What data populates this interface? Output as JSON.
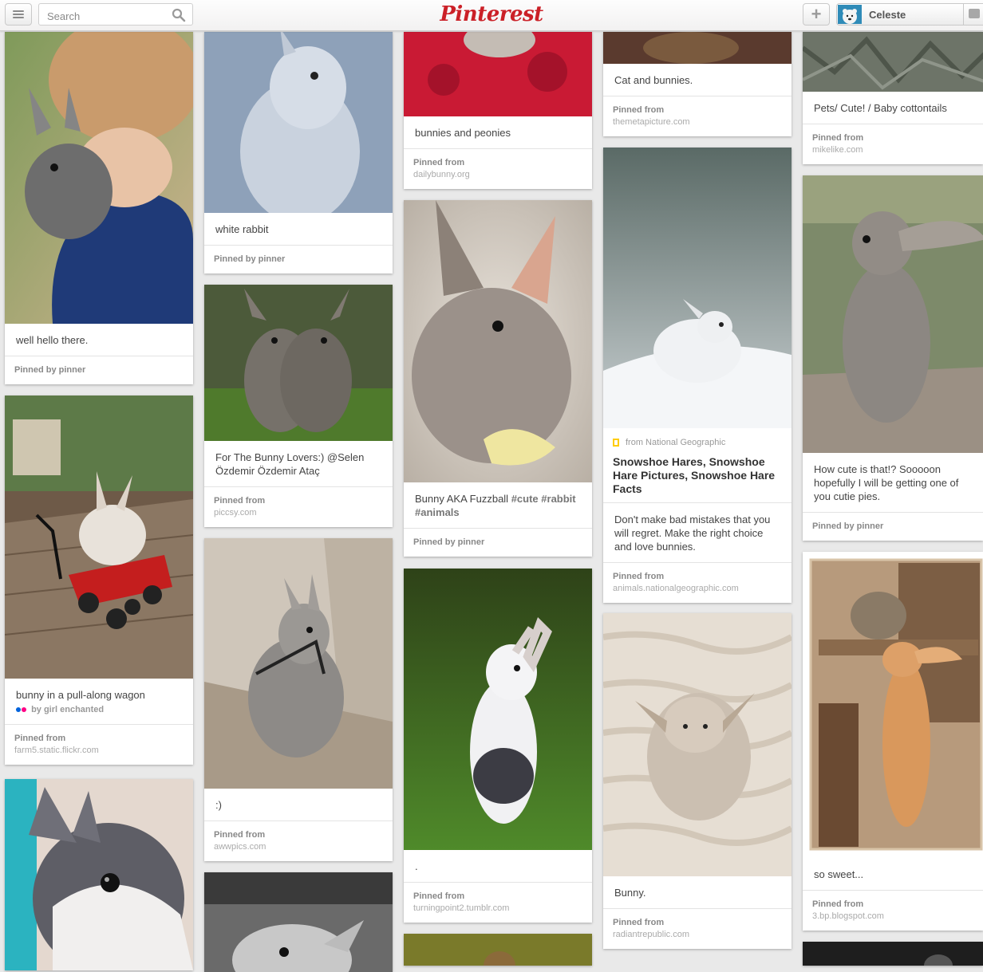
{
  "header": {
    "search_placeholder": "Search",
    "logo_text": "Pinterest",
    "user_name": "Celeste",
    "add_label": "+"
  },
  "colors": {
    "brand_red": "#cb2027",
    "background": "#e9e9e9"
  },
  "pins": [
    {
      "id": "c1p1",
      "description": "well hello there.",
      "attribution_label": "Pinned by pinner"
    },
    {
      "id": "c1p2",
      "description": "bunny in a pull-along wagon",
      "via": "by girl enchanted",
      "attribution_label": "Pinned from",
      "attribution_source": "farm5.static.flickr.com"
    },
    {
      "id": "c2p1",
      "description": "white rabbit",
      "attribution_label": "Pinned by pinner"
    },
    {
      "id": "c2p2",
      "description": "For The Bunny Lovers:) @Selen Özdemir Özdemir Ataç",
      "attribution_label": "Pinned from",
      "attribution_source": "piccsy.com"
    },
    {
      "id": "c2p3",
      "description": ":)",
      "attribution_label": "Pinned from",
      "attribution_source": "awwpics.com"
    },
    {
      "id": "c3p1",
      "description": "bunnies and peonies",
      "attribution_label": "Pinned from",
      "attribution_source": "dailybunny.org"
    },
    {
      "id": "c3p2",
      "description": "Bunny AKA Fuzzball ",
      "tag1": "#cute",
      "tag2": "#rabbit",
      "tag3": "#animals",
      "attribution_label": "Pinned by pinner"
    },
    {
      "id": "c3p3",
      "description": ".",
      "attribution_label": "Pinned from",
      "attribution_source": "turningpoint2.tumblr.com"
    },
    {
      "id": "c4p1",
      "description": "Cat and bunnies.",
      "attribution_label": "Pinned from",
      "attribution_source": "themetapicture.com"
    },
    {
      "id": "c4p2",
      "rich_source": "from National Geographic",
      "rich_title": "Snowshoe Hares, Snowshoe Hare Pictures, Snowshoe Hare Facts",
      "description": "Don't make bad mistakes that you will regret. Make the right choice and love bunnies.",
      "attribution_label": "Pinned from",
      "attribution_source": "animals.nationalgeographic.com"
    },
    {
      "id": "c4p3",
      "description": "Bunny.",
      "attribution_label": "Pinned from",
      "attribution_source": "radiantrepublic.com"
    },
    {
      "id": "c5p1",
      "description": "Pets/ Cute! / Baby cottontails",
      "attribution_label": "Pinned from",
      "attribution_source": "mikelike.com"
    },
    {
      "id": "c5p2",
      "description": "How cute is that!? Sooooon hopefully I will be getting one of you cutie pies.",
      "attribution_label": "Pinned by pinner"
    },
    {
      "id": "c5p3",
      "description": "so sweet...",
      "attribution_label": "Pinned from",
      "attribution_source": "3.bp.blogspot.com"
    }
  ]
}
